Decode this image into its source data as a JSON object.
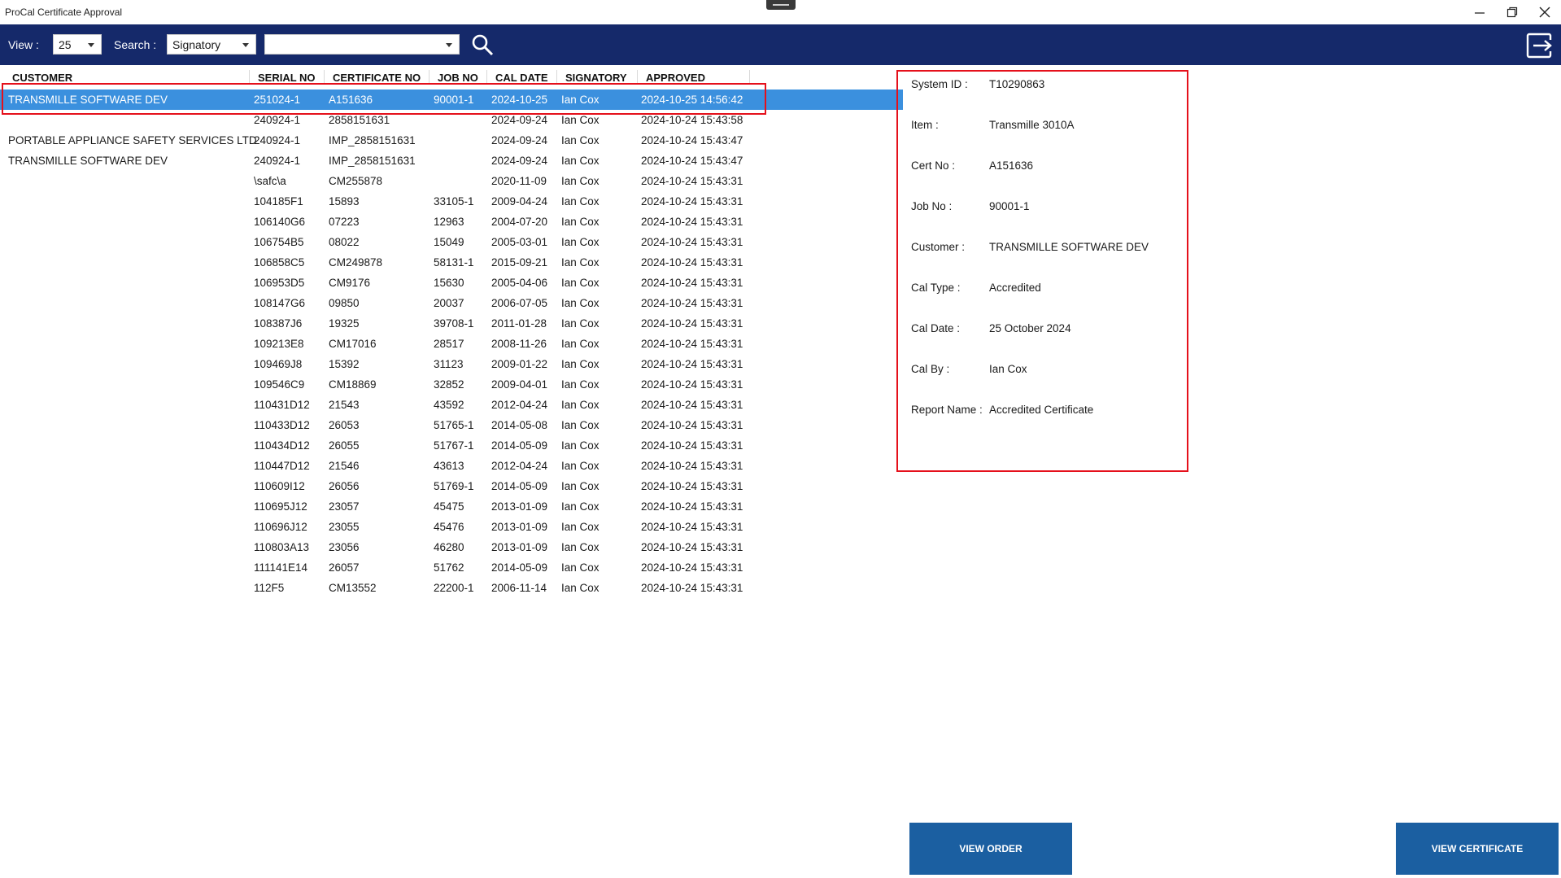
{
  "app": {
    "title": "ProCal Certificate Approval"
  },
  "toolbar": {
    "view_label": "View :",
    "view_value": "25",
    "search_label": "Search :",
    "search_field": "Signatory",
    "search_term": ""
  },
  "table": {
    "columns": [
      "CUSTOMER",
      "SERIAL NO",
      "CERTIFICATE NO",
      "JOB NO",
      "CAL DATE",
      "SIGNATORY",
      "APPROVED"
    ],
    "rows": [
      [
        "TRANSMILLE SOFTWARE DEV",
        "251024-1",
        "A151636",
        "90001-1",
        "2024-10-25",
        "Ian Cox",
        "2024-10-25 14:56:42"
      ],
      [
        "",
        "240924-1",
        "2858151631",
        "",
        "2024-09-24",
        "Ian Cox",
        "2024-10-24 15:43:58"
      ],
      [
        "PORTABLE APPLIANCE SAFETY SERVICES LTD",
        "240924-1",
        "IMP_2858151631",
        "",
        "2024-09-24",
        "Ian Cox",
        "2024-10-24 15:43:47"
      ],
      [
        "TRANSMILLE SOFTWARE DEV",
        "240924-1",
        "IMP_2858151631",
        "",
        "2024-09-24",
        "Ian Cox",
        "2024-10-24 15:43:47"
      ],
      [
        "",
        "\\safc\\a",
        "CM255878",
        "",
        "2020-11-09",
        "Ian Cox",
        "2024-10-24 15:43:31"
      ],
      [
        "",
        "104185F1",
        "15893",
        "33105-1",
        "2009-04-24",
        "Ian Cox",
        "2024-10-24 15:43:31"
      ],
      [
        "",
        "106140G6",
        "07223",
        "12963",
        "2004-07-20",
        "Ian Cox",
        "2024-10-24 15:43:31"
      ],
      [
        "",
        "106754B5",
        "08022",
        "15049",
        "2005-03-01",
        "Ian Cox",
        "2024-10-24 15:43:31"
      ],
      [
        "",
        "106858C5",
        "CM249878",
        "58131-1",
        "2015-09-21",
        "Ian Cox",
        "2024-10-24 15:43:31"
      ],
      [
        "",
        "106953D5",
        "CM9176",
        "15630",
        "2005-04-06",
        "Ian Cox",
        "2024-10-24 15:43:31"
      ],
      [
        "",
        "108147G6",
        "09850",
        "20037",
        "2006-07-05",
        "Ian Cox",
        "2024-10-24 15:43:31"
      ],
      [
        "",
        "108387J6",
        "19325",
        "39708-1",
        "2011-01-28",
        "Ian Cox",
        "2024-10-24 15:43:31"
      ],
      [
        "",
        "109213E8",
        "CM17016",
        "28517",
        "2008-11-26",
        "Ian Cox",
        "2024-10-24 15:43:31"
      ],
      [
        "",
        "109469J8",
        "15392",
        "31123",
        "2009-01-22",
        "Ian Cox",
        "2024-10-24 15:43:31"
      ],
      [
        "",
        "109546C9",
        "CM18869",
        "32852",
        "2009-04-01",
        "Ian Cox",
        "2024-10-24 15:43:31"
      ],
      [
        "",
        "110431D12",
        "21543",
        "43592",
        "2012-04-24",
        "Ian Cox",
        "2024-10-24 15:43:31"
      ],
      [
        "",
        "110433D12",
        "26053",
        "51765-1",
        "2014-05-08",
        "Ian Cox",
        "2024-10-24 15:43:31"
      ],
      [
        "",
        "110434D12",
        "26055",
        "51767-1",
        "2014-05-09",
        "Ian Cox",
        "2024-10-24 15:43:31"
      ],
      [
        "",
        "110447D12",
        "21546",
        "43613",
        "2012-04-24",
        "Ian Cox",
        "2024-10-24 15:43:31"
      ],
      [
        "",
        "110609I12",
        "26056",
        "51769-1",
        "2014-05-09",
        "Ian Cox",
        "2024-10-24 15:43:31"
      ],
      [
        "",
        "110695J12",
        "23057",
        "45475",
        "2013-01-09",
        "Ian Cox",
        "2024-10-24 15:43:31"
      ],
      [
        "",
        "110696J12",
        "23055",
        "45476",
        "2013-01-09",
        "Ian Cox",
        "2024-10-24 15:43:31"
      ],
      [
        "",
        "110803A13",
        "23056",
        "46280",
        "2013-01-09",
        "Ian Cox",
        "2024-10-24 15:43:31"
      ],
      [
        "",
        "111141E14",
        "26057",
        "51762",
        "2014-05-09",
        "Ian Cox",
        "2024-10-24 15:43:31"
      ],
      [
        "",
        "112F5",
        "CM13552",
        "22200-1",
        "2006-11-14",
        "Ian Cox",
        "2024-10-24 15:43:31"
      ]
    ],
    "selected_index": 0
  },
  "detail": [
    {
      "label": "System ID :",
      "value": "T10290863"
    },
    {
      "label": "Item :",
      "value": "Transmille 3010A"
    },
    {
      "label": "Cert No :",
      "value": "A151636"
    },
    {
      "label": "Job No :",
      "value": "90001-1"
    },
    {
      "label": "Customer :",
      "value": "TRANSMILLE SOFTWARE DEV"
    },
    {
      "label": "Cal Type :",
      "value": "Accredited"
    },
    {
      "label": "Cal Date :",
      "value": "25 October 2024"
    },
    {
      "label": "Cal By :",
      "value": "Ian Cox"
    },
    {
      "label": "Report Name :",
      "value": "Accredited Certificate"
    }
  ],
  "buttons": {
    "view_order": "VIEW ORDER",
    "view_certificate": "VIEW CERTIFICATE"
  },
  "icons": {
    "search": "search-icon",
    "exit": "exit-icon",
    "minimize": "minimize-icon",
    "maximize": "restore-icon",
    "close": "close-icon"
  },
  "colors": {
    "toolbar": "#15296a",
    "selection": "#3b90de",
    "button": "#1b5fa1",
    "highlight": "#e5101b"
  }
}
